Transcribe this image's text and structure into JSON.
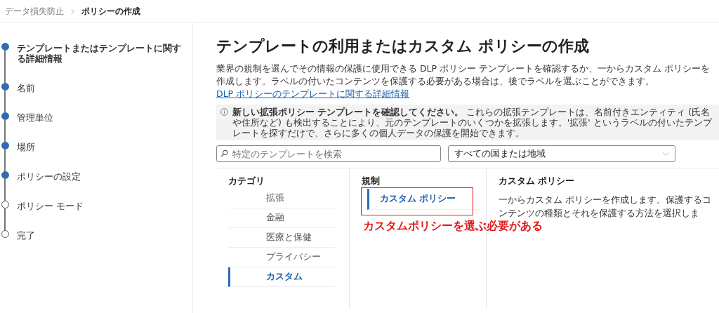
{
  "breadcrumb": [
    {
      "label": "データ損失防止",
      "current": false
    },
    {
      "label": "ポリシーの作成",
      "current": true
    }
  ],
  "steps": [
    {
      "label": "テンプレートまたはテンプレートに関する詳細情報",
      "completed": true,
      "selected": true
    },
    {
      "label": "名前",
      "completed": true,
      "selected": false
    },
    {
      "label": "管理単位",
      "completed": true,
      "selected": false
    },
    {
      "label": "場所",
      "completed": true,
      "selected": false
    },
    {
      "label": "ポリシーの設定",
      "completed": true,
      "selected": false
    },
    {
      "label": "ポリシー モード",
      "completed": false,
      "selected": false
    },
    {
      "label": "完了",
      "completed": false,
      "selected": false
    }
  ],
  "title": "テンプレートの利用またはカスタム ポリシーの作成",
  "description": "業界の規制を選んでその情報の保護に使用できる DLP ポリシー テンプレートを確認するか、一からカスタム ポリシーを作成します。ラベルの付いたコンテンツを保護する必要がある場合は、後でラベルを選ぶことができます。",
  "description_link": "DLP ポリシーのテンプレートに関する詳細情報",
  "banner": "**新しい拡張ポリシー テンプレートを確認してください。** これらの拡張テンプレートは、名前付きエンティティ (氏名や住所など) も検出することにより、元のテンプレートのいくつかを拡張します。'拡張' というラベルの付いたテンプレートを探すだけで、さらに多くの個人データの保護を開始できます。",
  "search": {
    "placeholder": "特定のテンプレートを検索"
  },
  "region_dropdown": {
    "value": "すべての国または地域"
  },
  "categories": {
    "heading": "カテゴリ",
    "items": [
      {
        "label": "拡張",
        "selected": false
      },
      {
        "label": "金融",
        "selected": false
      },
      {
        "label": "医療と保健",
        "selected": false
      },
      {
        "label": "プライバシー",
        "selected": false
      },
      {
        "label": "カスタム",
        "selected": true
      }
    ]
  },
  "regulations": {
    "heading": "規制",
    "items": [
      {
        "label": "カスタム ポリシー",
        "selected": true
      }
    ]
  },
  "details": {
    "heading": "カスタム ポリシー",
    "text": "一からカスタム ポリシーを作成します。保護するコンテンツの種類とそれを保護する方法を選択しま"
  },
  "annotation": {
    "text": "カスタムポリシーを選ぶ必要がある"
  }
}
